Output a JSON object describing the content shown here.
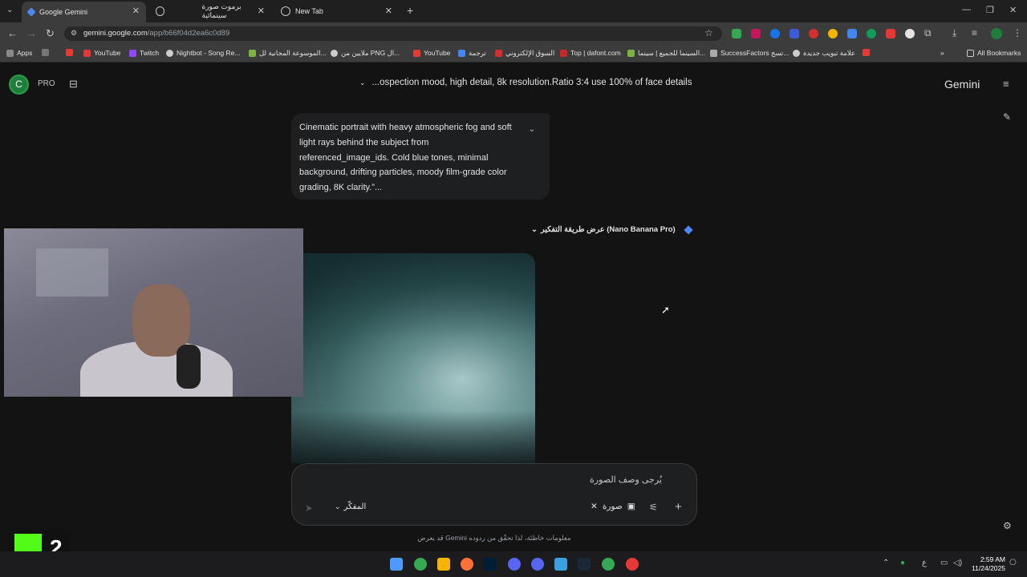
{
  "browser": {
    "tabs": [
      {
        "title": "Google Gemini",
        "active": true
      },
      {
        "title": "برموت صورة سينمائية",
        "active": false
      },
      {
        "title": "New Tab",
        "active": false
      }
    ],
    "url_host": "gemini.google.com",
    "url_path": "/app/b66f04d2ea6c0d89",
    "new_tab_label": "+"
  },
  "bookmarks": [
    "Apps",
    "YouTube",
    "Twitch",
    "Nightbot - Song Re...",
    "الموسوعة المجانية لل...",
    "ملايين من PNG ال...",
    "YouTube",
    "ترجمة",
    "السوق الإلكتروني",
    "Top | dafont.com",
    "السينما للجميع | سينما...",
    "SuccessFactors تسج...",
    "علامة تبويب جديدة",
    "All Bookmarks"
  ],
  "gemini": {
    "avatar_letter": "C",
    "plan": "PRO",
    "conversation_title": "...ospection mood, high detail, 8k resolution.Ratio 3:4 use 100% of face details",
    "brand": "Gemini",
    "user_prompt": "Cinematic portrait with heavy atmospheric fog and soft light rays behind the subject from referenced_image_ids. Cold blue tones, minimal background, drifting particles, moody film-grade color grading, 8K clarity.”...",
    "thinking_label": "عرض طريقة التفكير (Nano Banana Pro)",
    "input_placeholder": "يُرجى وصف الصورة",
    "mode_label": "المفكّر",
    "image_chip_label": "صورة",
    "disclaimer": "قد يعرض Gemini معلومات خاطئة، لذا تحقّق من ردوده"
  },
  "overlay": {
    "number": "2"
  },
  "taskbar": {
    "time": "2:59 AM",
    "date": "11/24/2025",
    "lang": "ع"
  }
}
